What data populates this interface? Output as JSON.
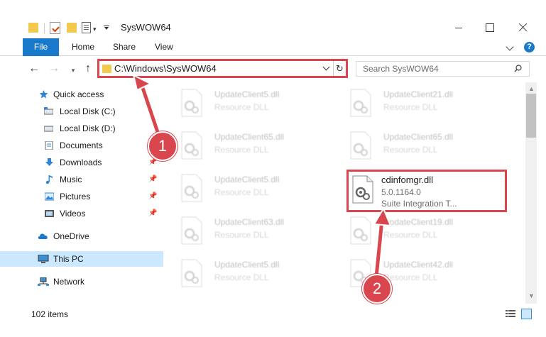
{
  "window": {
    "title": "SysWOW64"
  },
  "ribbon": {
    "tabs": [
      {
        "label": "File"
      },
      {
        "label": "Home"
      },
      {
        "label": "Share"
      },
      {
        "label": "View"
      }
    ],
    "help_label": "?"
  },
  "navigation": {
    "address": "C:\\Windows\\SysWOW64",
    "search_placeholder": "Search SysWOW64"
  },
  "sidebar": {
    "items": [
      {
        "label": "Quick access",
        "icon": "star-icon"
      },
      {
        "label": "Local Disk (C:)",
        "icon": "drive-icon"
      },
      {
        "label": "Local Disk (D:)",
        "icon": "drive-icon"
      },
      {
        "label": "Documents",
        "icon": "documents-icon"
      },
      {
        "label": "Downloads",
        "icon": "download-icon"
      },
      {
        "label": "Music",
        "icon": "music-icon"
      },
      {
        "label": "Pictures",
        "icon": "pictures-icon"
      },
      {
        "label": "Videos",
        "icon": "videos-icon"
      },
      {
        "label": "OneDrive",
        "icon": "cloud-icon"
      },
      {
        "label": "This PC",
        "icon": "computer-icon",
        "selected": true
      },
      {
        "label": "Network",
        "icon": "network-icon"
      }
    ]
  },
  "files": {
    "left_column": [
      {
        "name": "UpdateClient5.dll",
        "type": "Resource DLL"
      },
      {
        "name": "UpdateClient65.dll",
        "type": "Resource DLL"
      },
      {
        "name": "UpdateClient5.dll",
        "type": "Resource DLL"
      },
      {
        "name": "UpdateClient63.dll",
        "type": "Resource DLL"
      },
      {
        "name": "UpdateClient5.dll",
        "type": "Resource DLL"
      }
    ],
    "right_column": [
      {
        "name": "UpdateClient21.dll",
        "type": "Resource DLL"
      },
      {
        "name": "UpdateClient65.dll",
        "type": "Resource DLL"
      },
      {
        "name": "UpdateClient19.dll",
        "type": "Resource DLL"
      },
      {
        "name": "UpdateClient42.dll",
        "type": "Resource DLL"
      }
    ],
    "highlighted": {
      "name": "cdinfomgr.dll",
      "version": "5.0.1164.0",
      "description": "Suite Integration T..."
    }
  },
  "status": {
    "item_count": "102 items"
  },
  "annotations": {
    "step1": "1",
    "step2": "2"
  },
  "colors": {
    "accent": "#1979ca",
    "highlight": "#d9464e",
    "selected": "#cce8ff"
  }
}
